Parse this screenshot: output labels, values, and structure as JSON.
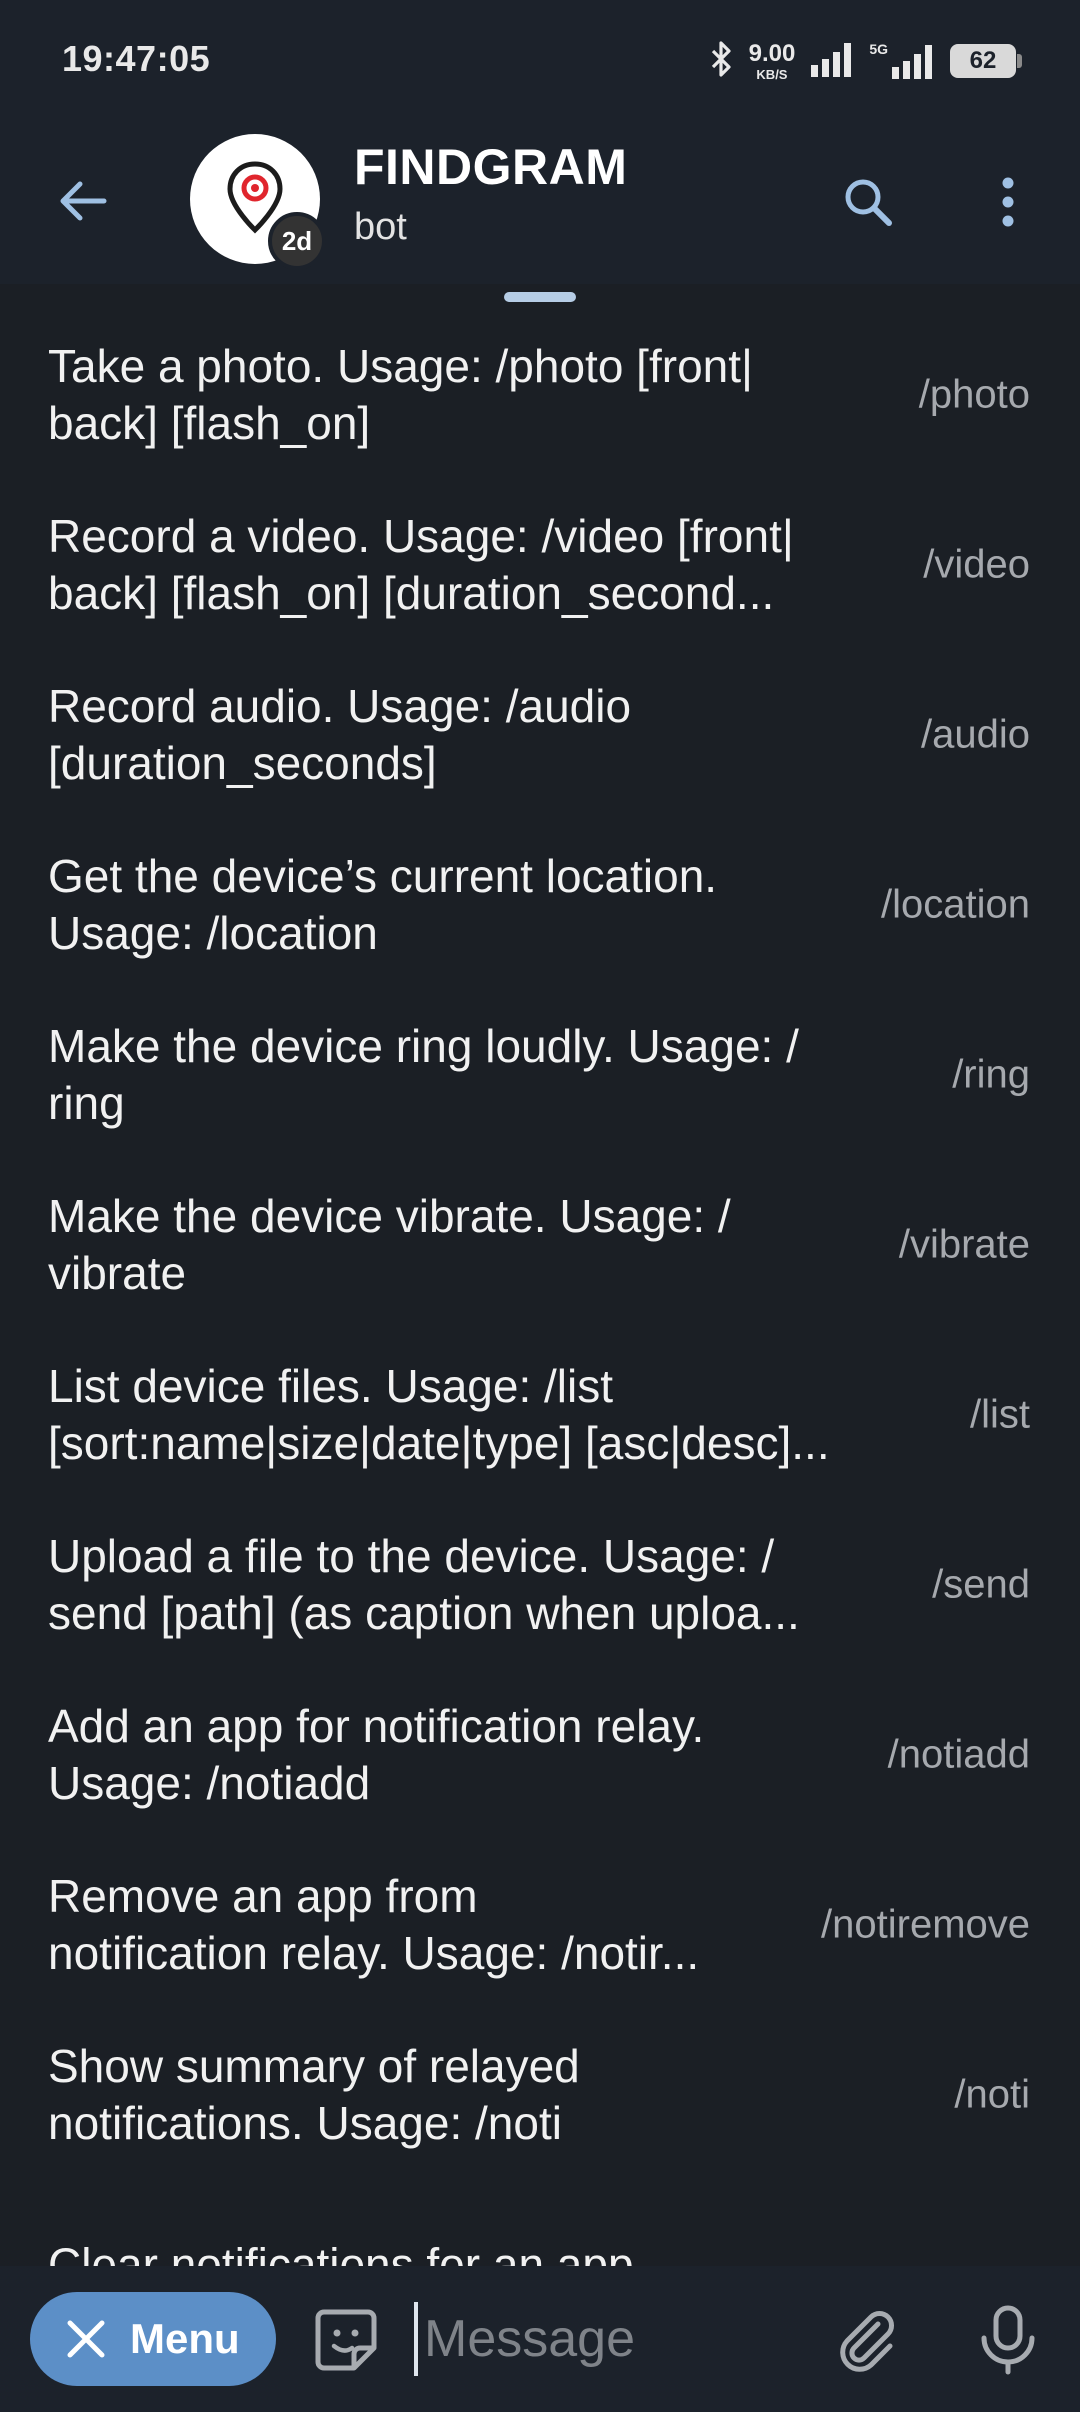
{
  "status_bar": {
    "time": "19:47:05",
    "net_speed_value": "9.00",
    "net_speed_unit": "KB/S",
    "network_type": "5G",
    "battery_level": "62",
    "icons": [
      "bluetooth-icon",
      "signal-icon",
      "signal-5g-icon",
      "battery-icon"
    ]
  },
  "header": {
    "title": "FINDGRAM",
    "subtitle": "bot",
    "avatar_badge": "2d",
    "accent_color": "#5c8fc7"
  },
  "commands": [
    {
      "description": "Take a photo. Usage: /photo [front|\nback] [flash_on]",
      "command": "/photo"
    },
    {
      "description": "Record a video. Usage: /video [front|\nback] [flash_on] [duration_second...",
      "command": "/video"
    },
    {
      "description": "Record audio. Usage: /audio\n[duration_seconds]",
      "command": "/audio"
    },
    {
      "description": "Get the device’s current location.\nUsage: /location",
      "command": "/location"
    },
    {
      "description": "Make the device ring loudly. Usage: /\nring",
      "command": "/ring"
    },
    {
      "description": "Make the device vibrate. Usage: /\nvibrate",
      "command": "/vibrate"
    },
    {
      "description": "List device files. Usage: /list\n[sort:name|size|date|type] [asc|desc]...",
      "command": "/list"
    },
    {
      "description": "Upload a file to the device. Usage: /\nsend [path] (as caption when uploa...",
      "command": "/send"
    },
    {
      "description": "Add an app for notification relay.\nUsage: /notiadd",
      "command": "/notiadd"
    },
    {
      "description": "Remove an app from\nnotification relay. Usage: /notir...",
      "command": "/notiremove"
    },
    {
      "description": "Show summary of relayed\nnotifications. Usage: /noti",
      "command": "/noti"
    },
    {
      "description": "Clear notifications for an app",
      "command": ""
    }
  ],
  "input_bar": {
    "menu_label": "Menu",
    "placeholder": "Message"
  }
}
